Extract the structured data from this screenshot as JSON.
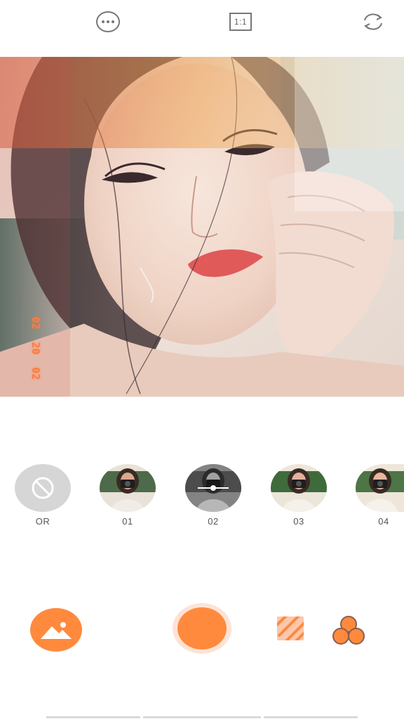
{
  "topbar": {
    "more_icon": "more-horizontal-icon",
    "ratio_label": "1:1",
    "switch_icon": "camera-switch-icon"
  },
  "photo": {
    "date_stamp": [
      "02",
      "20",
      "02"
    ]
  },
  "filters": {
    "items": [
      {
        "label": "OR"
      },
      {
        "label": "01"
      },
      {
        "label": "02"
      },
      {
        "label": "03"
      },
      {
        "label": "04"
      }
    ]
  },
  "bottombar": {
    "gallery_icon": "gallery-mountain-icon",
    "shutter": "shutter-button",
    "texture_icon": "texture-stripes-icon",
    "blend_icon": "blend-circles-icon"
  },
  "colors": {
    "accent": "#ff8a3d",
    "accent_light": "#fde3d6",
    "icon_gray": "#777777",
    "none_thumb": "#d6d6d6"
  }
}
